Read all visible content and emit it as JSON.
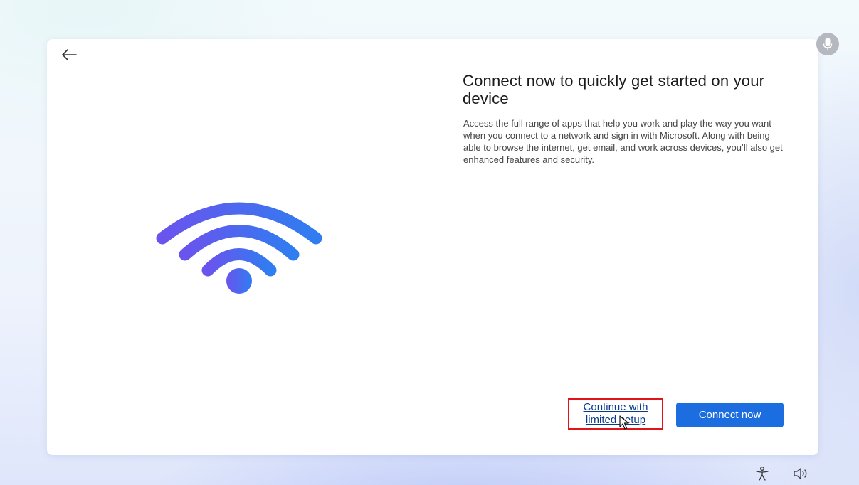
{
  "dialog": {
    "heading": "Connect now to quickly get started on your device",
    "description": "Access the full range of apps that help you work and play the way you want when you connect to a network and sign in with Microsoft. Along with being able to browse the internet, get email, and work across devices, you’ll also get enhanced features and security.",
    "limited_setup_label": "Continue with limited setup",
    "connect_label": "Connect now"
  },
  "icons": {
    "back": "back-arrow-icon",
    "illustration": "wifi-icon",
    "microphone": "microphone-icon",
    "accessibility": "accessibility-icon",
    "volume": "volume-icon",
    "cursor": "mouse-cursor-icon"
  },
  "colors": {
    "accent": "#1b6de0",
    "highlight_border": "#e01419",
    "wifi_gradient_start": "#6a54ee",
    "wifi_gradient_end": "#2f7df0"
  }
}
